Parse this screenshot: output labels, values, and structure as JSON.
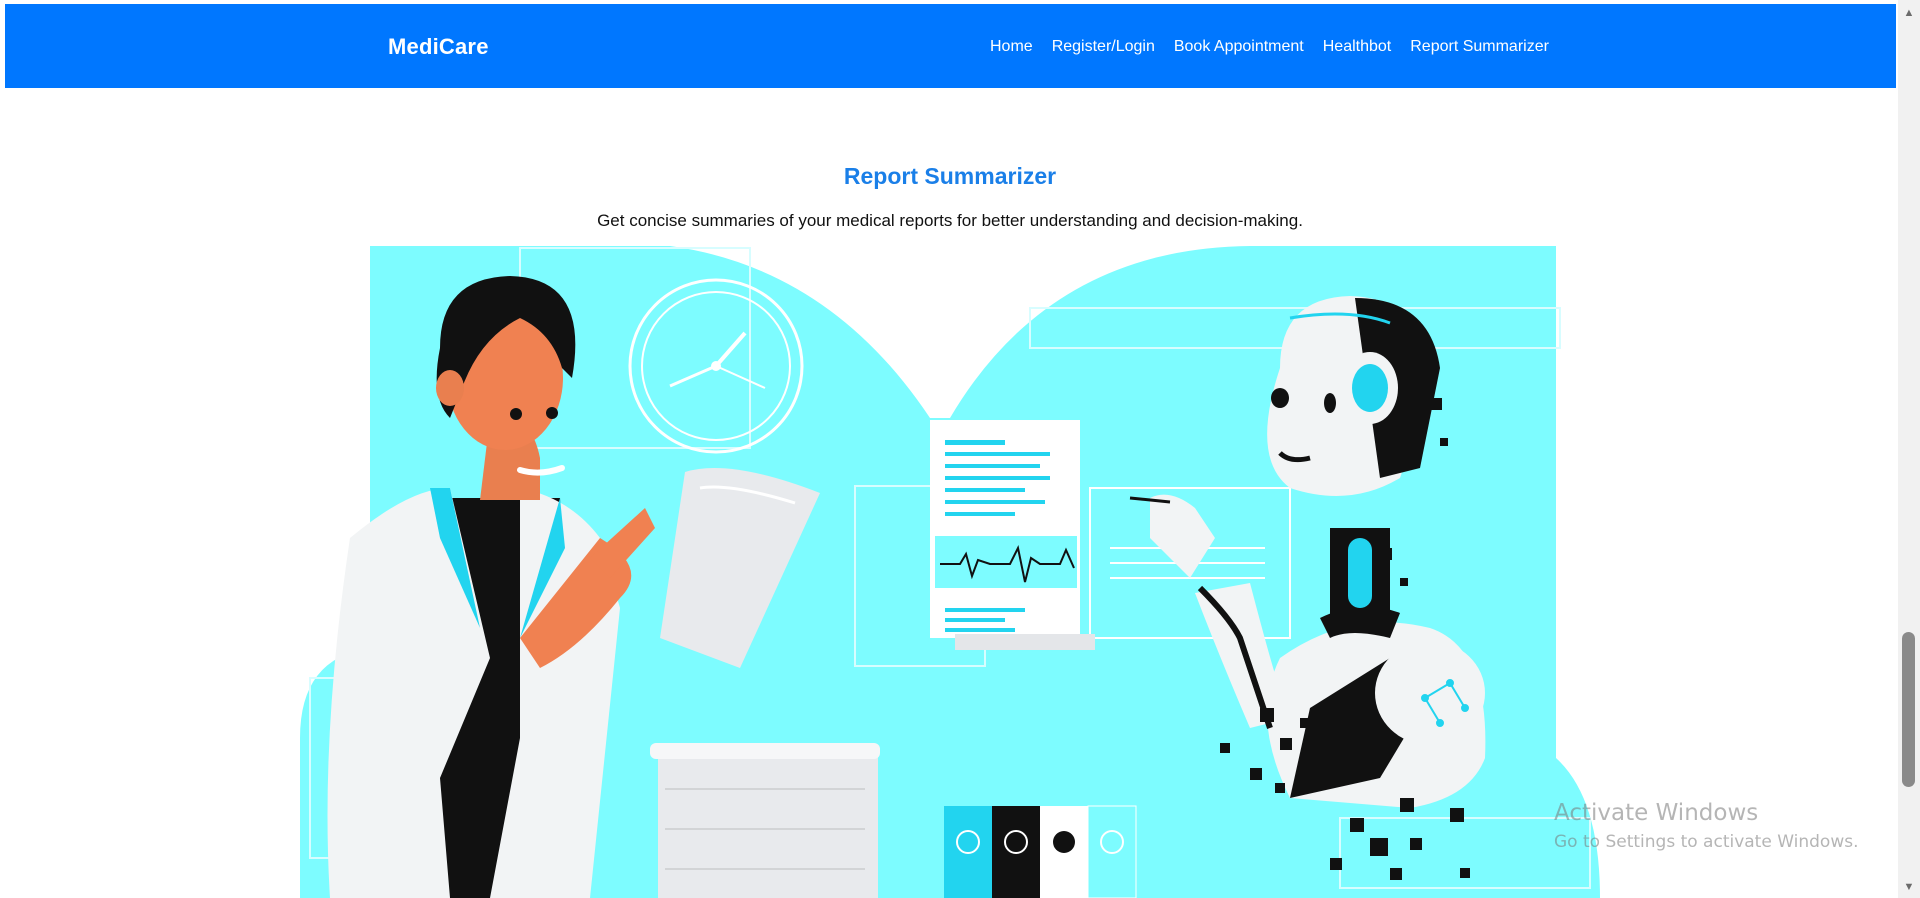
{
  "navbar": {
    "brand": "MediCare",
    "links": [
      "Home",
      "Register/Login",
      "Book Appointment",
      "Healthbot",
      "Report Summarizer"
    ]
  },
  "main": {
    "title": "Report Summarizer",
    "subtitle": "Get concise summaries of your medical reports for better understanding and decision-making."
  },
  "illustration": {
    "icon": "doctor-robot-report-illustration"
  },
  "watermark": {
    "title": "Activate Windows",
    "subtitle": "Go to Settings to activate Windows."
  },
  "colors": {
    "nav_bg": "#0077ff",
    "title": "#1a7fe8",
    "cyan_bg": "#7dfcff",
    "cyan_accent": "#22d4ef"
  }
}
